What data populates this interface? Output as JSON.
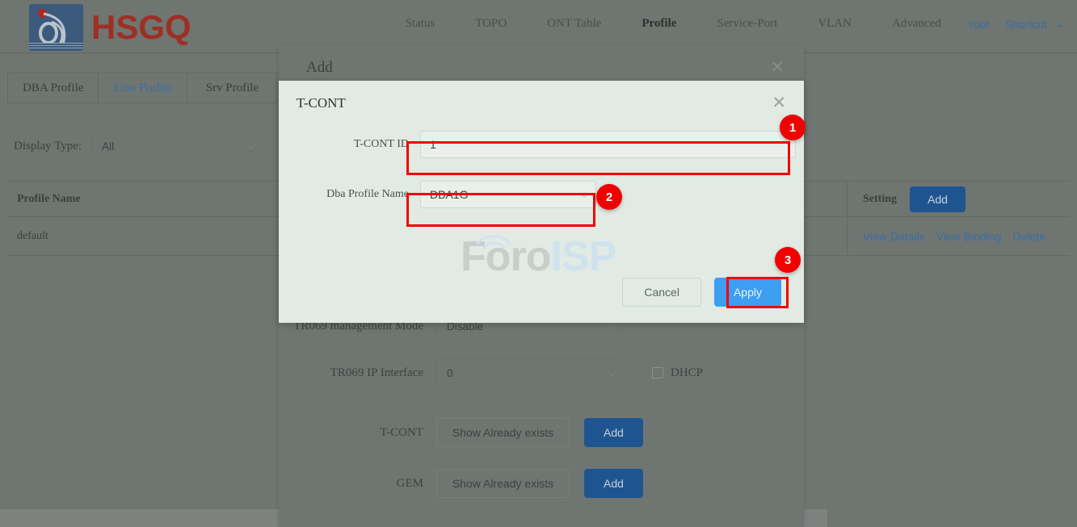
{
  "header": {
    "logo_text": "HSGQ",
    "logo_icon": "hsgq-flame-logo-icon",
    "nav": [
      {
        "label": "Status",
        "active": false
      },
      {
        "label": "TOPO",
        "active": false
      },
      {
        "label": "ONT Table",
        "active": false
      },
      {
        "label": "Profile",
        "active": true
      },
      {
        "label": "Service-Port",
        "active": false
      },
      {
        "label": "VLAN",
        "active": false
      },
      {
        "label": "Advanced",
        "active": false
      }
    ],
    "user": "root",
    "shortcut": "Shortcut"
  },
  "tabs": [
    {
      "label": "DBA Profile",
      "active": false
    },
    {
      "label": "Line Profile",
      "active": true
    },
    {
      "label": "Srv Profile",
      "active": false
    }
  ],
  "filter": {
    "label": "Display Type:",
    "value": "All"
  },
  "table": {
    "columns": [
      "Profile Name",
      "Setting"
    ],
    "header_add_label": "Add",
    "rows": [
      {
        "profile_name": "default",
        "actions": [
          "View Details",
          "View Binding",
          "Delete"
        ]
      }
    ]
  },
  "add_modal": {
    "title": "Add",
    "close_icon": "close-icon",
    "fields": [
      {
        "label": "TR069 management Mode",
        "value": "Disable",
        "type": "select"
      },
      {
        "label": "TR069 IP Interface",
        "value": "0",
        "type": "select",
        "checkbox_label": "DHCP"
      },
      {
        "label": "T-CONT",
        "value": "Show Already exists",
        "type": "textbox",
        "button": "Add"
      },
      {
        "label": "GEM",
        "value": "Show Already exists",
        "type": "textbox",
        "button": "Add"
      }
    ]
  },
  "tcont_modal": {
    "title": "T-CONT",
    "close_icon": "close-icon",
    "tcont_id": {
      "label": "T-CONT ID",
      "value": "1",
      "placeholder": ""
    },
    "dba_profile": {
      "label": "Dba Profile Name",
      "value": "DBA1G"
    },
    "cancel_label": "Cancel",
    "apply_label": "Apply"
  },
  "annotations": [
    {
      "number": "1",
      "target": "tcont-id-input"
    },
    {
      "number": "2",
      "target": "dba-profile-select"
    },
    {
      "number": "3",
      "target": "apply-button"
    }
  ],
  "watermark": {
    "part1": "Foro",
    "part2": "ISP"
  },
  "colors": {
    "accent_blue": "#3a6ea5",
    "button_blue": "#1e5590",
    "apply_blue": "#3d9ef2",
    "annotation_red": "#f20000",
    "logo_red": "#9e2f25"
  }
}
